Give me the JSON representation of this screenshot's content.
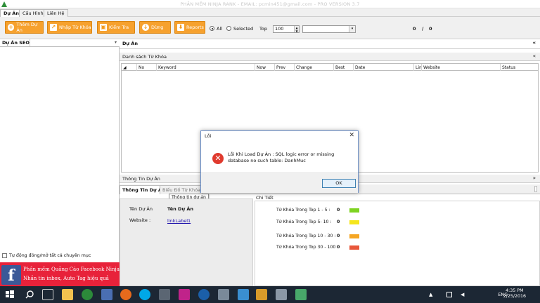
{
  "window": {
    "title": "PHẦN MỀM NINJA RANK - EMAIL: pcmin451@gmail.com - PRO VERSION 3.7"
  },
  "menu_tabs": [
    "Dự Án",
    "Cấu Hình",
    "Liên Hệ"
  ],
  "toolbar": {
    "buttons": [
      "Thêm Dự Án",
      "Nhập Từ Khóa",
      "Kiểm Tra",
      "Dừng",
      "Reports"
    ],
    "radio_all": "All",
    "radio_selected": "Selected",
    "top_label": "Top",
    "top_value": "100",
    "counter_left": "0",
    "counter_sep": "/",
    "counter_right": "0"
  },
  "left_panel": {
    "header": "Dự Án SEO",
    "auto_toggle_label": "Tự động đóng/mở tất cả chuyên mục",
    "banner_title": "Phần mềm Quảng Cáo Facebook Ninja",
    "banner_subtitle": "Nhắn tin inbox, Auto Tag hiệu quả",
    "banner_logo": "f"
  },
  "project_section": {
    "title": "Dự Án",
    "keywords_title": "Danh sách Từ Khóa",
    "columns": [
      "No",
      "Keyword",
      "Now",
      "Prev",
      "Change",
      "Best",
      "Date",
      "Lin",
      "Website",
      "Status"
    ]
  },
  "project_info": {
    "section_title": "Thông Tin Dự Án",
    "tabs": [
      "Thông Tin Dự Án",
      "Biểu Đồ Từ Khóa"
    ],
    "tooltip": "Thông tin dự án",
    "name_label": "Tên Dự Án",
    "name_value": "Tên Dự Án",
    "website_label": "Website :",
    "website_link": "linkLabel1",
    "detail_title": "Chi Tiết",
    "tiers": [
      {
        "label": "Từ Khóa Trong Top 1 - 5 :",
        "count": "0",
        "color": "#7ed321"
      },
      {
        "label": "Từ Khóa Trong Top 5- 10 :",
        "count": "0",
        "color": "#f5e61c"
      },
      {
        "label": "Từ Khóa Trong Top 10 - 30 :",
        "count": "0",
        "color": "#f5a623"
      },
      {
        "label": "Từ Khóa Trong Top 30 - 100 :",
        "count": "0",
        "color": "#e8573a"
      }
    ]
  },
  "dialog": {
    "title": "Lỗi",
    "message": "Lỗi Khi Load Dự Án : SQL logic error or missing database no such table: DanhMuc",
    "ok_label": "OK"
  },
  "taskbar": {
    "language": "ENG",
    "time": "4:35 PM",
    "date": "2/25/2016"
  }
}
